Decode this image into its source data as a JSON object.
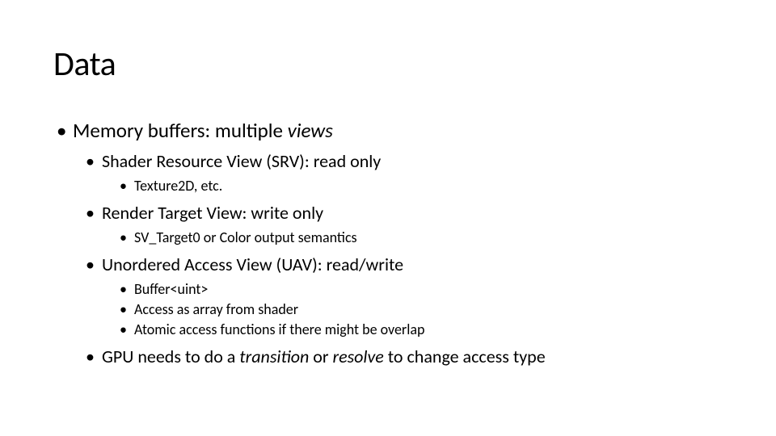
{
  "title": "Data",
  "l1": {
    "a": {
      "pre": "Memory buffers: multiple ",
      "em": "views"
    }
  },
  "l2": {
    "a": "Shader Resource View (SRV): read only",
    "b": "Render Target View: write only",
    "c": "Unordered Access View (UAV): read/write",
    "d": {
      "pre": "GPU needs to do a ",
      "em1": "transition",
      "mid": " or ",
      "em2": "resolve",
      "post": " to change access type"
    }
  },
  "l3": {
    "a1": "Texture2D, etc.",
    "b1": "SV_Target0 or Color output semantics",
    "c1": "Buffer<uint>",
    "c2": "Access as array from shader",
    "c3": "Atomic access functions if there might be overlap"
  }
}
